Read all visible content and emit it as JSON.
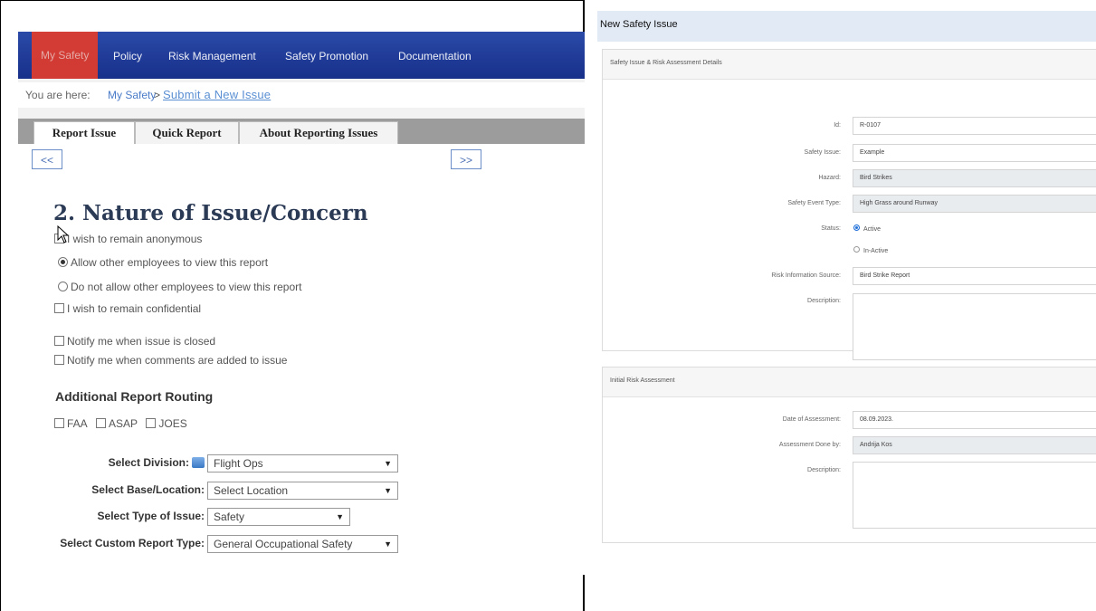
{
  "left": {
    "nav": {
      "items": [
        {
          "label": "My Safety",
          "active": true
        },
        {
          "label": "Policy"
        },
        {
          "label": "Risk Management"
        },
        {
          "label": "Safety Promotion"
        },
        {
          "label": "Documentation"
        }
      ]
    },
    "breadcrumb": {
      "prefix": "You are here:",
      "link": "My Safety",
      "sep": ">",
      "current": "Submit a New Issue"
    },
    "tabs": [
      "Report Issue",
      "Quick Report",
      "About Reporting Issues"
    ],
    "prev_label": "<<",
    "next_label": ">>",
    "section_title": "2. Nature of Issue/Concern",
    "options": {
      "anonymous": "I wish to remain anonymous",
      "allow_view": "Allow other employees to view this report",
      "disallow_view": "Do not allow other employees to view this report",
      "confidential": "I wish to remain confidential",
      "notify_closed": "Notify me when issue is closed",
      "notify_comments": "Notify me when comments are added to issue"
    },
    "routing": {
      "title": "Additional Report Routing",
      "items": [
        "FAA",
        "ASAP",
        "JOES"
      ]
    },
    "selects": {
      "division": {
        "label": "Select Division:",
        "value": "Flight Ops"
      },
      "base": {
        "label": "Select Base/Location:",
        "value": "Select Location"
      },
      "type": {
        "label": "Select Type of Issue:",
        "value": "Safety"
      },
      "custom": {
        "label": "Select Custom Report Type:",
        "value": "General Occupational Safety"
      }
    },
    "colors": {
      "nav": "#1e3a95",
      "nav_active": "#e23c2c"
    }
  },
  "right": {
    "title": "New Safety Issue",
    "details": {
      "heading": "Safety Issue & Risk Assessment Details",
      "id_label": "Id:",
      "id_value": "R-0107",
      "issue_label": "Safety Issue:",
      "issue_value": "Example",
      "hazard_label": "Hazard:",
      "hazard_value": "Bird Strikes",
      "event_label": "Safety Event Type:",
      "event_value": "High Grass around Runway",
      "status_label": "Status:",
      "status_active": "Active",
      "status_inactive": "In-Active",
      "source_label": "Risk Information Source:",
      "source_value": "Bird Strike Report",
      "desc_label": "Description:"
    },
    "initial": {
      "heading": "Initial Risk Assessment",
      "date_label": "Date of Assessment:",
      "date_value": "08.09.2023.",
      "by_label": "Assessment Done by:",
      "by_value": "Andrija Kos",
      "desc_label": "Description:"
    },
    "colors": {
      "header": "#e2eaf6",
      "radio": "#1e6fd9"
    }
  }
}
